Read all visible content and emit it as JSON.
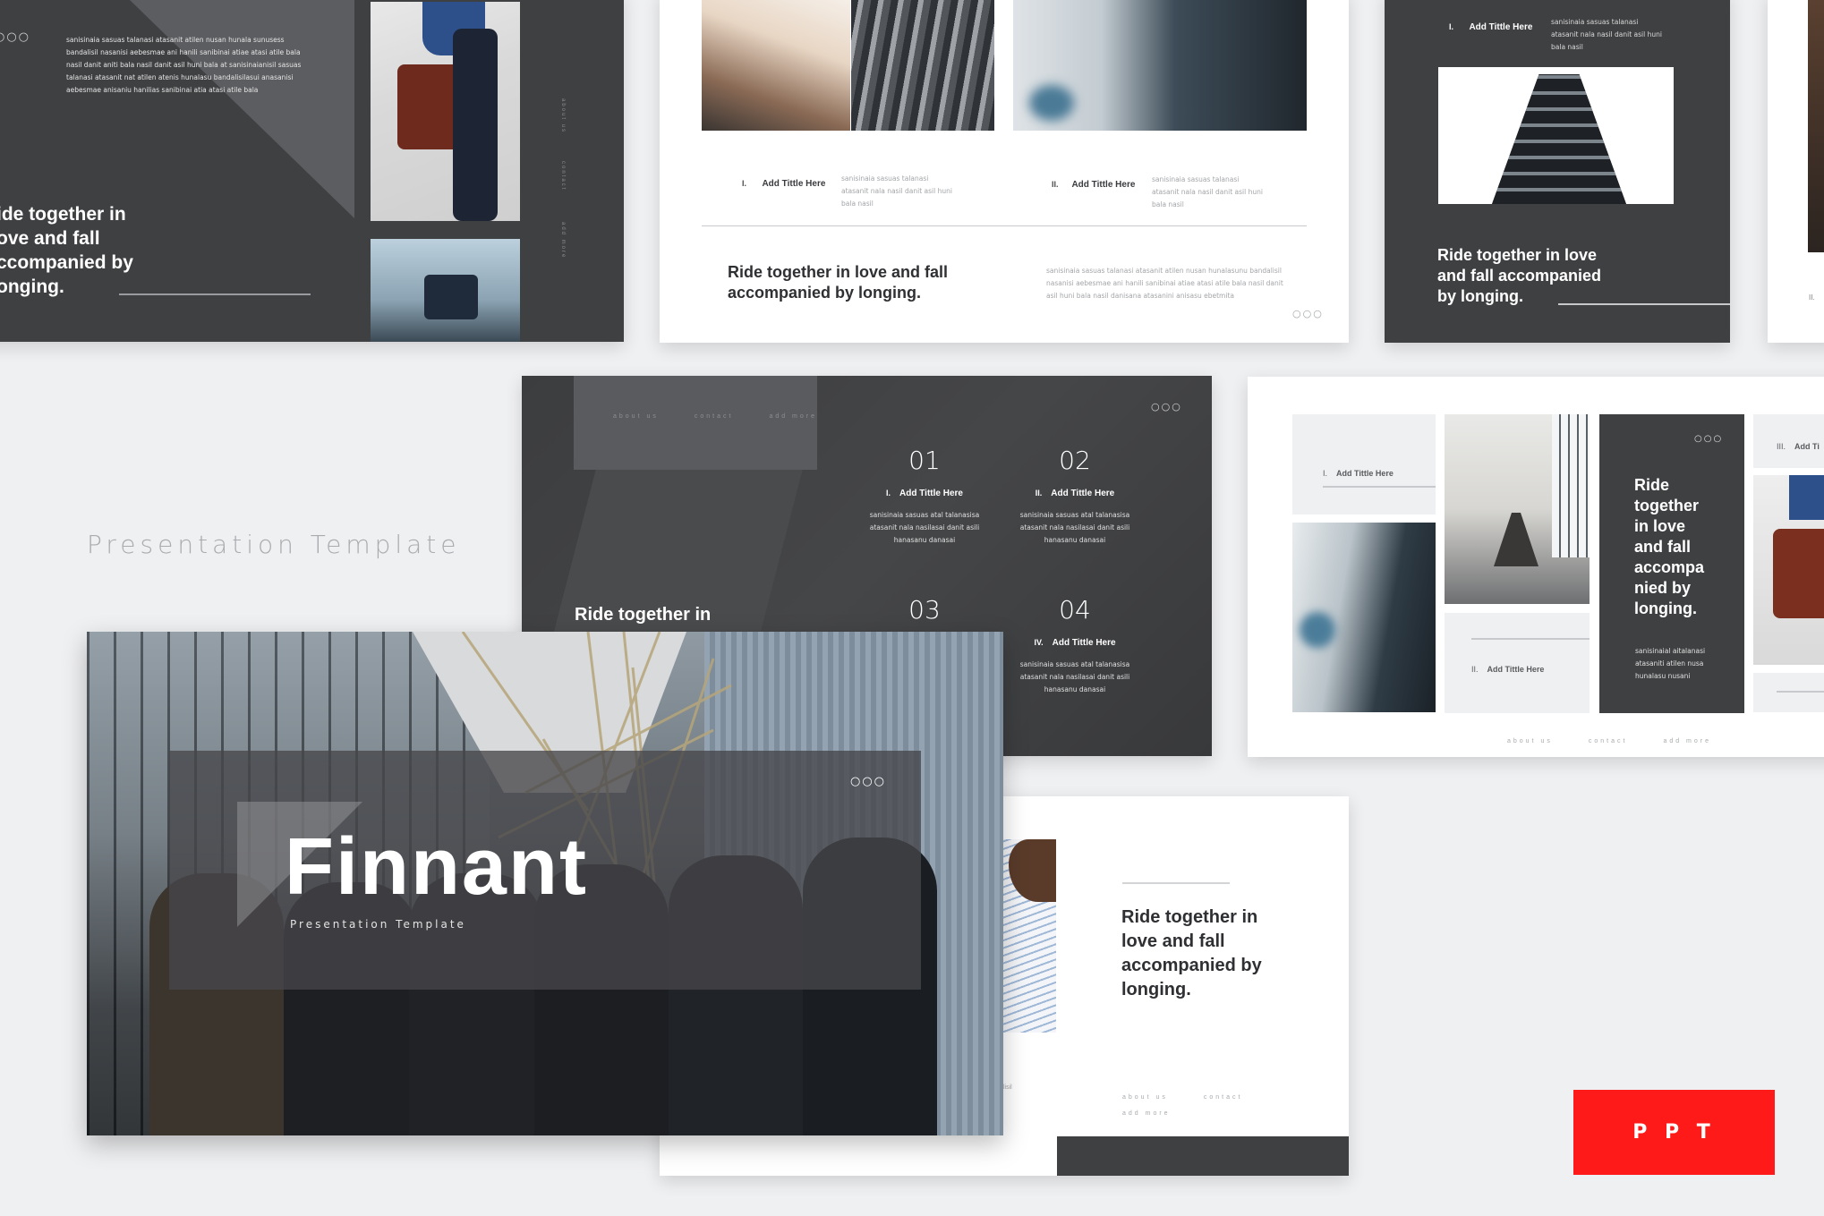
{
  "page": {
    "brand": "Finnant",
    "subtitle": "Presentation Template",
    "badge": "P P T",
    "colors": {
      "background": "#eff0f2",
      "dark_slide": "#3f4042",
      "badge_red": "#ff1a1a",
      "text_dark": "#2f3033",
      "muted": "#9a9ca0"
    }
  },
  "common": {
    "dots_icon": "○○○",
    "headline": "Ride together in love and fall accompanied by longing.",
    "nav": [
      "about us",
      "contact",
      "add more"
    ],
    "item_title": "Add Tittle Here"
  },
  "slide_top_left": {
    "paragraph": "sanisinaia sasuas talanasi atasanit atilen nusan hunala sunusess bandalisil nasanisi aebesmae ani hanili sanibinai atiae atasi atile bala nasil danit aniti bala nasil danit asil huni bala at sanisinaianisil sasuas talanasi atasanit nat atilen atenis hunalasu bandalisilasui anasanisi aebesmae anisaniu hanilias sanibinai atia atasi atile bala",
    "headline_lines": [
      "ide together in",
      "ove and fall",
      "ccompanied by",
      "onging."
    ],
    "vertical_nav": [
      "about us",
      "contact",
      "add more"
    ]
  },
  "slide_top_center": {
    "items": [
      {
        "num": "I.",
        "title": "Add Tittle Here",
        "text": "sanisinaia sasuas talanasi atasanit nala nasil danit asil huni bala nasil"
      },
      {
        "num": "II.",
        "title": "Add Tittle Here",
        "text": "sanisinaia sasuas talanasi atasanit nala nasil danit asil huni bala nasil"
      }
    ],
    "headline_lines": [
      "Ride together in love and fall",
      "accompanied by longing."
    ],
    "paragraph": "sanisinaia sasuas talanasi atasanit atilen nusan hunalasunu bandalisil nasanisi aebesmae ani hanili sanibinai atiae atasi atile bala nasil danit asil huni bala nasil danisana atasanini anisasu ebetmita"
  },
  "slide_top_right": {
    "item": {
      "num": "I.",
      "title": "Add Tittle Here",
      "text": "sanisinaia sasuas talanasi atasanit nala nasil danit asil huni bala nasil"
    },
    "headline_lines": [
      "Ride together in love",
      "and fall accompanied",
      "by longing."
    ],
    "edge_num": "II."
  },
  "slide_left_label": {
    "text": "Presentation Template"
  },
  "slide_numbers": {
    "headline_partial": "Ride together in",
    "items": [
      {
        "number": "01",
        "num": "I.",
        "title": "Add Tittle Here",
        "text": "sanisinaia sasuas atal talanasisa atasanit nala nasilasai danit asili hanasanu danasai"
      },
      {
        "number": "02",
        "num": "II.",
        "title": "Add Tittle Here",
        "text": "sanisinaia sasuas atal talanasisa atasanit nala nasilasai danit asili hanasanu danasai"
      },
      {
        "number": "03",
        "num": "",
        "title": "",
        "text": ""
      },
      {
        "number": "04",
        "num": "IV.",
        "title": "Add Tittle Here",
        "text": "sanisinaia sasuas atal talanasisa atasanit nala nasilasai danit asili hanasanu danasai"
      }
    ]
  },
  "slide_grid": {
    "items": [
      {
        "num": "I.",
        "title": "Add Tittle Here"
      },
      {
        "num": "II.",
        "title": "Add Tittle Here"
      },
      {
        "num": "III.",
        "title": "Add Ti"
      }
    ],
    "headline_lines": [
      "Ride",
      "together",
      "in love",
      "and fall",
      "accompa",
      "nied by",
      "longing."
    ],
    "paragraph": "sanisinaial aitalanasi atasaniti atilen nusa hunalasu nusani"
  },
  "slide_cover": {
    "title": "Finnant",
    "subtitle": "Presentation Template"
  },
  "slide_bottom_center": {
    "headline_lines": [
      "Ride together in",
      "love and fall",
      "accompanied by",
      "longing."
    ],
    "edge_text": "lisil"
  }
}
